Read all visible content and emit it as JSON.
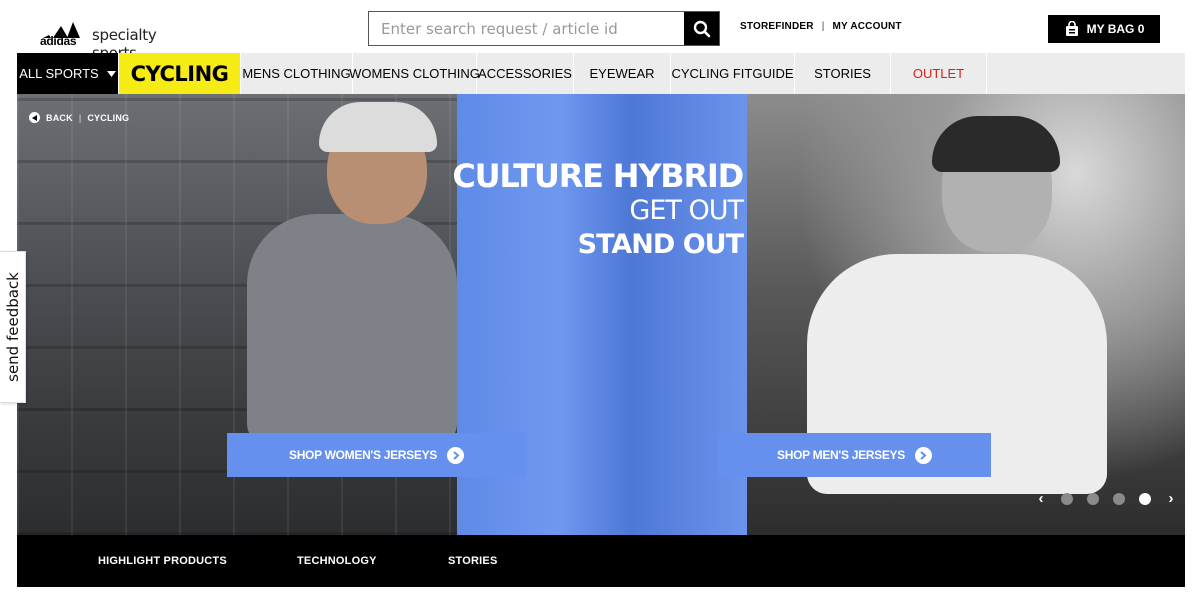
{
  "header": {
    "logo": {
      "brand": "adidas",
      "subtitle": "specialty sports",
      "icon": "adidas-three-stripes-logo"
    },
    "search": {
      "placeholder": "Enter search request / article id",
      "value": "",
      "icon": "search-icon"
    },
    "links": {
      "storefinder": "STOREFINDER",
      "separator": "|",
      "my_account": "MY ACCOUNT"
    },
    "bag": {
      "label": "MY BAG 0",
      "icon": "shopping-bag-icon"
    }
  },
  "nav": {
    "all_sports": "ALL SPORTS",
    "all_sports_icon": "caret-down-icon",
    "current_sport": "CYCLING",
    "items": [
      {
        "label": "MENS CLOTHING"
      },
      {
        "label": "WOMENS CLOTHING"
      },
      {
        "label": "ACCESSORIES"
      },
      {
        "label": "EYEWEAR"
      },
      {
        "label": "CYCLING FITGUIDE"
      },
      {
        "label": "STORIES"
      },
      {
        "label": "OUTLET"
      }
    ],
    "colors": {
      "current_sport_bg": "#f6eb14",
      "outlet": "#e01b1b"
    }
  },
  "hero": {
    "breadcrumb": {
      "back": "BACK",
      "separator": "|",
      "current": "CYCLING"
    },
    "headline": {
      "line1": "CULTURE HYBRID",
      "line2": "GET OUT",
      "line3": "STAND OUT"
    },
    "cta_women": "SHOP WOMEN'S JERSEYS",
    "cta_men": "SHOP MEN'S JERSEYS",
    "carousel": {
      "slide_count": 4,
      "active_index": 3,
      "prev_icon": "chevron-left-icon",
      "next_icon": "chevron-right-icon"
    },
    "colors": {
      "accent_blue": "#6590ee"
    }
  },
  "feedback": {
    "label": "send feedback"
  },
  "subnav": {
    "tabs": [
      {
        "label": "HIGHLIGHT PRODUCTS"
      },
      {
        "label": "TECHNOLOGY"
      },
      {
        "label": "STORIES"
      }
    ]
  }
}
